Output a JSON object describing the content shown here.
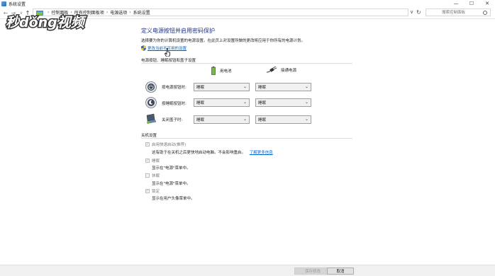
{
  "window": {
    "title": "系统设置",
    "minimize": "—",
    "maximize": "☐",
    "close": "✕"
  },
  "nav": {
    "back": "←",
    "forward": "→",
    "recent": "∨",
    "up": "↑",
    "breadcrumb": [
      "控制面板",
      "所有控制面板项",
      "电源选项",
      "系统设置"
    ],
    "separator": "›",
    "dropdown": "∨",
    "refresh": "↻",
    "search_placeholder": "搜索控制面板"
  },
  "watermark": {
    "text": "秒懂视频"
  },
  "page": {
    "heading": "定义电源按钮并启用密码保护",
    "description": "选择要为你的计算机设置的电源设置。在此页上对设置所做的更改将应用于你所有的电源计划。",
    "change_link": "更改当前不可用的设置"
  },
  "power_section": {
    "title": "电源按钮、睡眠按钮和盖子设置",
    "col_battery": "用电池",
    "col_plugged": "接通电源",
    "rows": [
      {
        "label": "按电源按钮时:",
        "battery": "睡眠",
        "plugged": "睡眠"
      },
      {
        "label": "按睡眠按钮时:",
        "battery": "睡眠",
        "plugged": "睡眠"
      },
      {
        "label": "关闭盖子时:",
        "battery": "睡眠",
        "plugged": "睡眠"
      }
    ]
  },
  "shutdown_section": {
    "title": "关机设置",
    "items": [
      {
        "label": "启用快速启动(推荐)",
        "checked": true,
        "desc": "这有助于在关机之后更快地启动电脑。不会影响重启。",
        "link": "了解更多信息"
      },
      {
        "label": "睡眠",
        "checked": true,
        "desc": "显示在\"电源\"菜单中。"
      },
      {
        "label": "休眠",
        "checked": false,
        "desc": "显示在\"电源\"菜单中。"
      },
      {
        "label": "锁定",
        "checked": true,
        "desc": "显示在用户头像菜单中。"
      }
    ]
  },
  "buttons": {
    "save": "保存修改",
    "cancel": "取消"
  }
}
